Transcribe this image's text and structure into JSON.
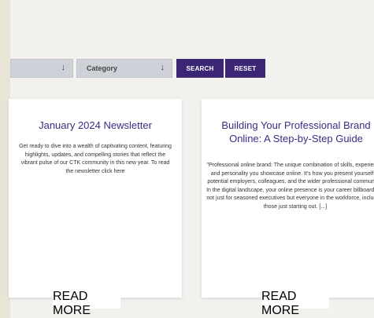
{
  "filters": {
    "first_select_arrow": "↓",
    "category_label": "Category",
    "category_arrow": "↓",
    "search_label": "SEARCH",
    "reset_label": "RESET"
  },
  "cards": [
    {
      "title": "January 2024 Newsletter",
      "excerpt": "Get ready to dive into a wealth of captivating content, featuring highlights, updates, and compelling stories that reflect the vibrant pulse of our CTK community in this new year. To read the newsletter click here",
      "button": "READ MORE"
    },
    {
      "title": "Building Your Professional Brand Online: A Step-by-Step Guide",
      "excerpt": "\"Professional online brand: The unique combination of skills, experience, and personality you showcase online. It's how you present yourself to potential employers, colleagues, and the wider professional community.\" In the digital landscape, your online presence is your career billboard. It's not just for seasoned executives but everyone in the workforce, including those just starting out. [...]",
      "button": "READ MORE"
    }
  ]
}
